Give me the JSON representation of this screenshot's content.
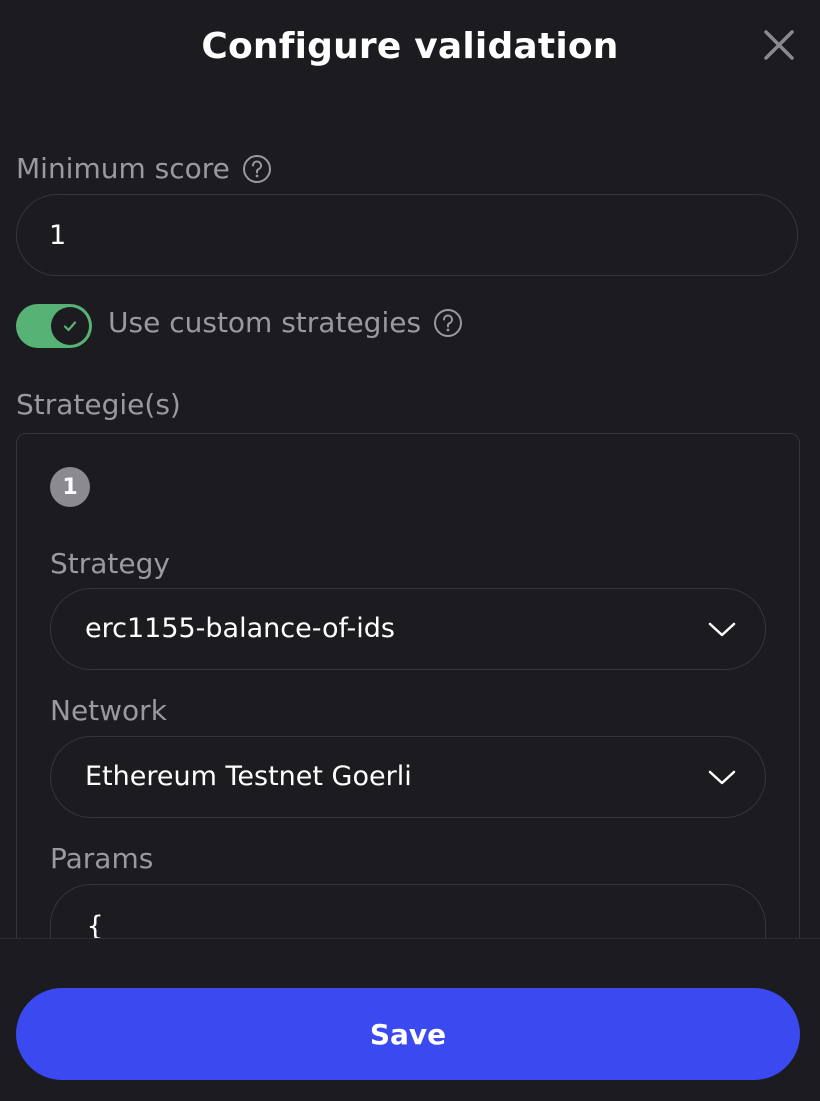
{
  "modal": {
    "title": "Configure validation",
    "close_icon": "close-icon"
  },
  "minimum_score": {
    "label": "Minimum score",
    "value": "1",
    "help_icon": "question-circle-icon"
  },
  "custom_strategies": {
    "label": "Use custom strategies",
    "enabled": true,
    "help_icon": "question-circle-icon"
  },
  "strategies": {
    "label": "Strategie(s)",
    "items": [
      {
        "index": "1",
        "strategy_label": "Strategy",
        "strategy_value": "erc1155-balance-of-ids",
        "network_label": "Network",
        "network_value": "Ethereum Testnet Goerli",
        "params_label": "Params",
        "params_value": "{"
      }
    ]
  },
  "footer": {
    "save_label": "Save"
  },
  "colors": {
    "background": "#1c1b20",
    "border": "#36353b",
    "muted_text": "#9a999f",
    "toggle_on": "#57b375",
    "primary": "#3b4af0"
  }
}
